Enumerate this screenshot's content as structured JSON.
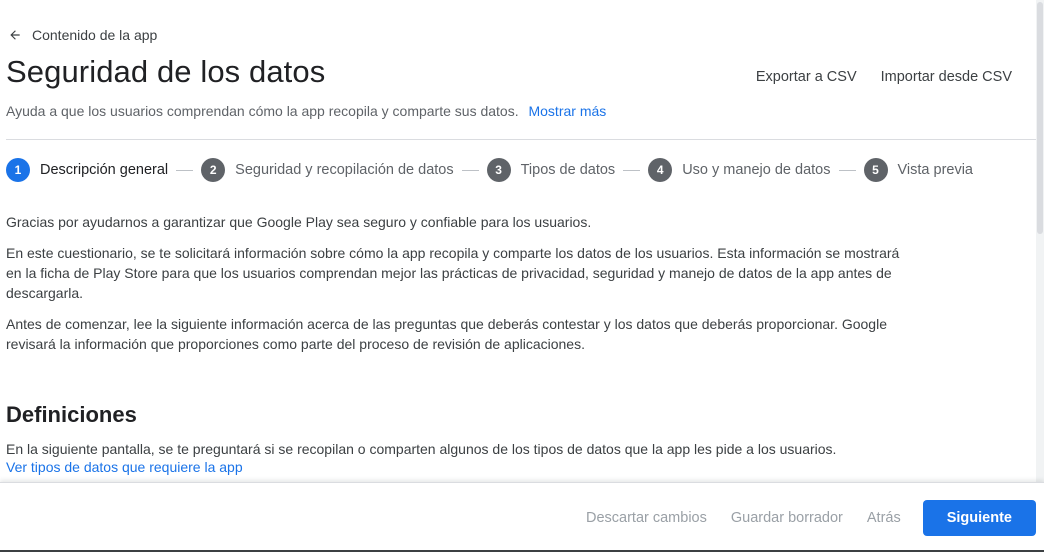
{
  "nav": {
    "back_label": "Contenido de la app"
  },
  "header": {
    "title": "Seguridad de los datos",
    "subtitle": "Ayuda a que los usuarios comprendan cómo la app recopila y comparte sus datos.",
    "show_more": "Mostrar más",
    "actions": {
      "export_csv": "Exportar a CSV",
      "import_csv": "Importar desde CSV"
    }
  },
  "stepper": {
    "steps": [
      {
        "number": "1",
        "label": "Descripción general",
        "active": true
      },
      {
        "number": "2",
        "label": "Seguridad y recopilación de datos",
        "active": false
      },
      {
        "number": "3",
        "label": "Tipos de datos",
        "active": false
      },
      {
        "number": "4",
        "label": "Uso y manejo de datos",
        "active": false
      },
      {
        "number": "5",
        "label": "Vista previa",
        "active": false
      }
    ]
  },
  "intro": {
    "paragraphs": [
      "Gracias por ayudarnos a garantizar que Google Play sea seguro y confiable para los usuarios.",
      "En este cuestionario, se te solicitará información sobre cómo la app recopila y comparte los datos de los usuarios. Esta información se mostrará en la ficha de Play Store para que los usuarios comprendan mejor las prácticas de privacidad, seguridad y manejo de datos de la app antes de descargarla.",
      "Antes de comenzar, lee la siguiente información acerca de las preguntas que deberás contestar y los datos que deberás proporcionar. Google revisará la información que proporciones como parte del proceso de revisión de aplicaciones."
    ]
  },
  "definitions": {
    "title": "Definiciones",
    "text": "En la siguiente pantalla, se te preguntará si se recopilan o comparten algunos de los tipos de datos que la app les pide a los usuarios.",
    "link": "Ver tipos de datos que requiere la app"
  },
  "footer": {
    "discard": "Descartar cambios",
    "save_draft": "Guardar borrador",
    "back": "Atrás",
    "next": "Siguiente"
  },
  "colors": {
    "accent": "#1a73e8",
    "step_inactive": "#5f6368",
    "disabled_text": "#9aa0a6"
  },
  "icons": {
    "back": "arrow-left-icon"
  }
}
